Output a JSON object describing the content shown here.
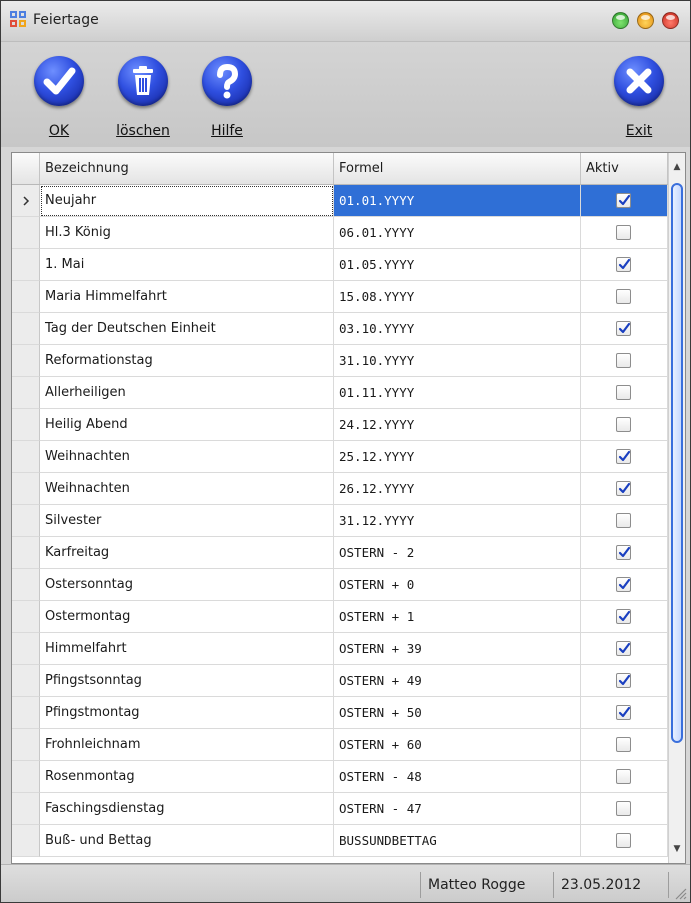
{
  "window": {
    "title": "Feiertage",
    "accent_color": "#2f4fe0",
    "controls": [
      {
        "name": "minimize",
        "color": "#3fbf3f"
      },
      {
        "name": "maximize",
        "color": "#f0a51c"
      },
      {
        "name": "close",
        "color": "#d93a2b"
      }
    ]
  },
  "toolbar": {
    "ok": {
      "label": "OK",
      "icon": "checkmark-icon"
    },
    "delete": {
      "label": "löschen",
      "icon": "trash-icon"
    },
    "help": {
      "label": "Hilfe",
      "icon": "question-mark-icon"
    },
    "exit": {
      "label": "Exit",
      "icon": "x-icon"
    }
  },
  "grid": {
    "columns": [
      "Bezeichnung",
      "Formel",
      "Aktiv"
    ],
    "selected_row": 0,
    "rows": [
      {
        "name": "Neujahr",
        "formula": "01.01.YYYY",
        "active": true
      },
      {
        "name": "Hl.3 König",
        "formula": "06.01.YYYY",
        "active": false
      },
      {
        "name": "1. Mai",
        "formula": "01.05.YYYY",
        "active": true
      },
      {
        "name": "Maria Himmelfahrt",
        "formula": "15.08.YYYY",
        "active": false
      },
      {
        "name": "Tag der Deutschen Einheit",
        "formula": "03.10.YYYY",
        "active": true
      },
      {
        "name": "Reformationstag",
        "formula": "31.10.YYYY",
        "active": false
      },
      {
        "name": "Allerheiligen",
        "formula": "01.11.YYYY",
        "active": false
      },
      {
        "name": "Heilig Abend",
        "formula": "24.12.YYYY",
        "active": false
      },
      {
        "name": "Weihnachten",
        "formula": "25.12.YYYY",
        "active": true
      },
      {
        "name": "Weihnachten",
        "formula": "26.12.YYYY",
        "active": true
      },
      {
        "name": "Silvester",
        "formula": "31.12.YYYY",
        "active": false
      },
      {
        "name": "Karfreitag",
        "formula": "OSTERN - 2",
        "active": true
      },
      {
        "name": "Ostersonntag",
        "formula": "OSTERN + 0",
        "active": true
      },
      {
        "name": "Ostermontag",
        "formula": "OSTERN + 1",
        "active": true
      },
      {
        "name": "Himmelfahrt",
        "formula": "OSTERN + 39",
        "active": true
      },
      {
        "name": "Pfingstsonntag",
        "formula": "OSTERN + 49",
        "active": true
      },
      {
        "name": "Pfingstmontag",
        "formula": "OSTERN + 50",
        "active": true
      },
      {
        "name": "Frohnleichnam",
        "formula": "OSTERN + 60",
        "active": false
      },
      {
        "name": "Rosenmontag",
        "formula": "OSTERN - 48",
        "active": false
      },
      {
        "name": "Faschingsdienstag",
        "formula": "OSTERN - 47",
        "active": false
      },
      {
        "name": "Buß- und Bettag",
        "formula": "BUSSUNDBETTAG",
        "active": false
      }
    ]
  },
  "status": {
    "user": "Matteo Rogge",
    "date": "23.05.2012"
  }
}
